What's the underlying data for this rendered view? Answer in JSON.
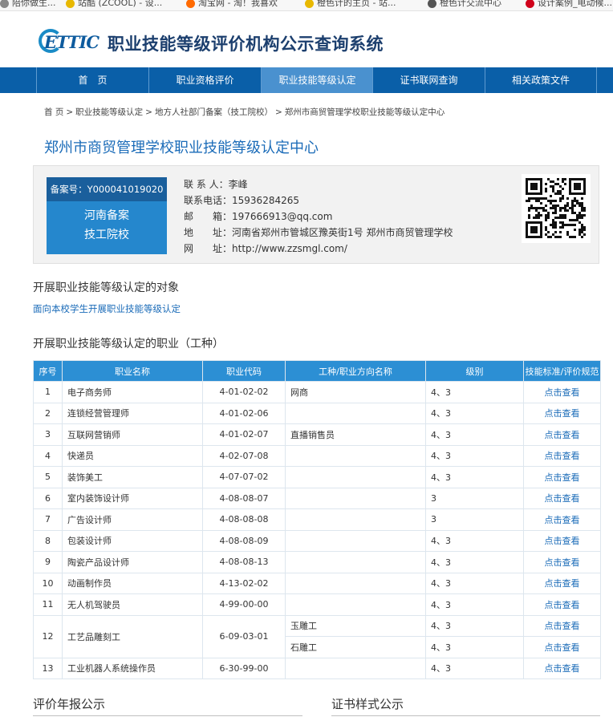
{
  "bookmarks": [
    {
      "label": "陪你做生...",
      "color": "#888888"
    },
    {
      "label": "站酷 (ZCOOL) - 设...",
      "color": "#e8b800"
    },
    {
      "label": "淘宝网 - 淘！我喜欢",
      "color": "#ff6a00"
    },
    {
      "label": "橙色计的主页 - 站...",
      "color": "#e8b800"
    },
    {
      "label": "橙色计交流中心",
      "color": "#555555"
    },
    {
      "label": "设计案例_电动候...",
      "color": "#d0021b"
    }
  ],
  "header": {
    "logo_text": "ETTIC",
    "title": "职业技能等级评价机构公示查询系统"
  },
  "nav": [
    {
      "label": "首　页",
      "active": false
    },
    {
      "label": "职业资格评价",
      "active": false
    },
    {
      "label": "职业技能等级认定",
      "active": true
    },
    {
      "label": "证书联网查询",
      "active": false
    },
    {
      "label": "相关政策文件",
      "active": false
    }
  ],
  "breadcrumb": [
    "首 页",
    "职业技能等级认定",
    "地方人社部门备案（技工院校）",
    "郑州市商贸管理学校职业技能等级认定中心"
  ],
  "page_title": "郑州市商贸管理学校职业技能等级认定中心",
  "badge": {
    "record_no": "备案号：Y000041019020",
    "line1": "河南备案",
    "line2": "技工院校"
  },
  "contact": {
    "person_label": "联 系 人：",
    "person": "李峰",
    "phone_label": "联系电话：",
    "phone": "15936284265",
    "email_label": "邮　　箱：",
    "email": "197666913@qq.com",
    "address_label": "地　　址：",
    "address": "河南省郑州市管城区豫英街1号 郑州市商贸管理学校",
    "website_label": "网　　址：",
    "website": "http://www.zzsmgl.com/"
  },
  "targets": {
    "heading": "开展职业技能等级认定的对象",
    "text": "面向本校学生开展职业技能等级认定"
  },
  "occupations": {
    "heading": "开展职业技能等级认定的职业（工种）",
    "columns": [
      "序号",
      "职业名称",
      "职业代码",
      "工种/职业方向名称",
      "级别",
      "技能标准/评价规范"
    ],
    "link_label": "点击查看",
    "rows": [
      {
        "no": "1",
        "name": "电子商务师",
        "code": "4-01-02-02",
        "sub": [
          "网商"
        ],
        "levels": [
          "4、3"
        ]
      },
      {
        "no": "2",
        "name": "连锁经营管理师",
        "code": "4-01-02-06",
        "sub": [
          ""
        ],
        "levels": [
          "4、3"
        ]
      },
      {
        "no": "3",
        "name": "互联网营销师",
        "code": "4-01-02-07",
        "sub": [
          "直播销售员"
        ],
        "levels": [
          "4、3"
        ]
      },
      {
        "no": "4",
        "name": "快递员",
        "code": "4-02-07-08",
        "sub": [
          ""
        ],
        "levels": [
          "4、3"
        ]
      },
      {
        "no": "5",
        "name": "装饰美工",
        "code": "4-07-07-02",
        "sub": [
          ""
        ],
        "levels": [
          "4、3"
        ]
      },
      {
        "no": "6",
        "name": "室内装饰设计师",
        "code": "4-08-08-07",
        "sub": [
          ""
        ],
        "levels": [
          "3"
        ]
      },
      {
        "no": "7",
        "name": "广告设计师",
        "code": "4-08-08-08",
        "sub": [
          ""
        ],
        "levels": [
          "3"
        ]
      },
      {
        "no": "8",
        "name": "包装设计师",
        "code": "4-08-08-09",
        "sub": [
          ""
        ],
        "levels": [
          "4、3"
        ]
      },
      {
        "no": "9",
        "name": "陶瓷产品设计师",
        "code": "4-08-08-13",
        "sub": [
          ""
        ],
        "levels": [
          "4、3"
        ]
      },
      {
        "no": "10",
        "name": "动画制作员",
        "code": "4-13-02-02",
        "sub": [
          ""
        ],
        "levels": [
          "4、3"
        ]
      },
      {
        "no": "11",
        "name": "无人机驾驶员",
        "code": "4-99-00-00",
        "sub": [
          ""
        ],
        "levels": [
          "4、3"
        ]
      },
      {
        "no": "12",
        "name": "工艺品雕刻工",
        "code": "6-09-03-01",
        "sub": [
          "玉雕工",
          "石雕工"
        ],
        "levels": [
          "4、3",
          "4、3"
        ]
      },
      {
        "no": "13",
        "name": "工业机器人系统操作员",
        "code": "6-30-99-00",
        "sub": [
          ""
        ],
        "levels": [
          "4、3"
        ]
      }
    ]
  },
  "bottom": {
    "annual_report": "评价年报公示",
    "certificate_sample": "证书样式公示"
  }
}
